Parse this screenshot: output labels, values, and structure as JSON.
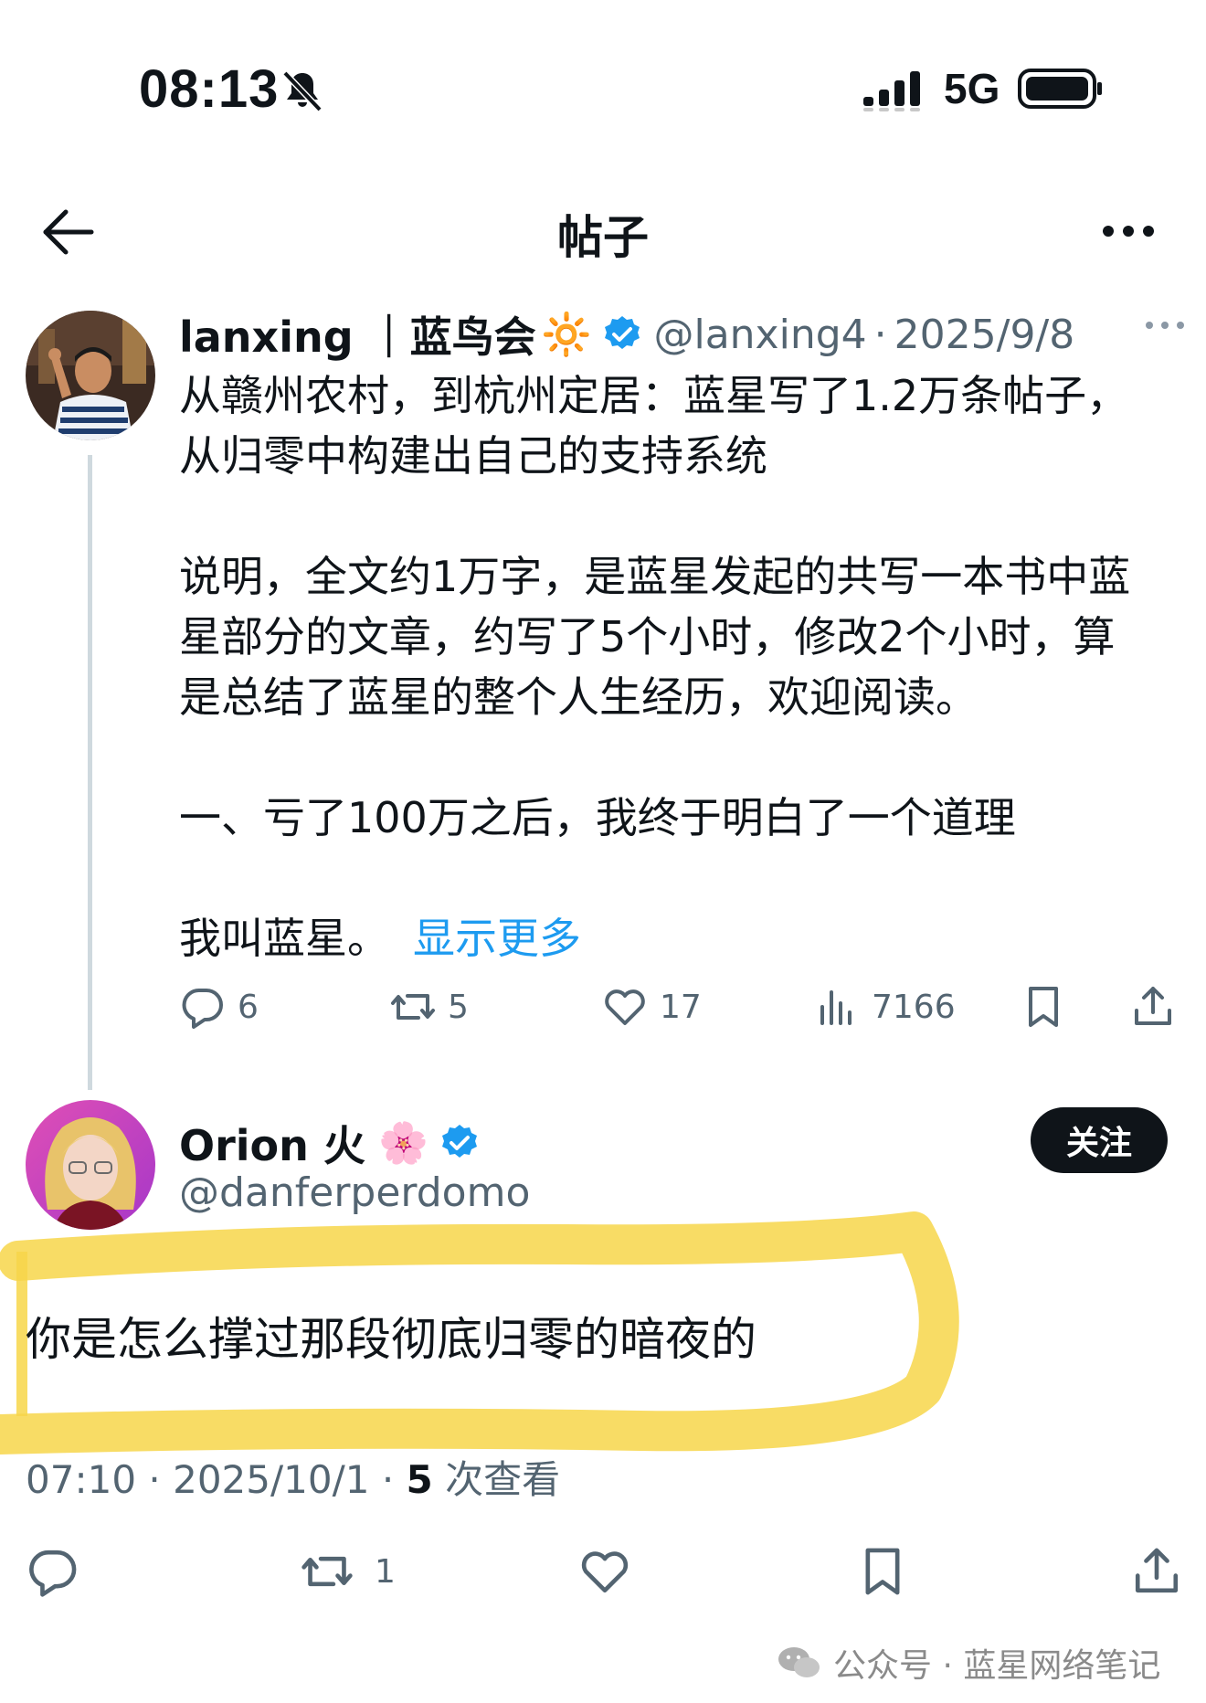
{
  "status_bar": {
    "time": "08:13",
    "network": "5G",
    "icons": [
      "bell-off-icon",
      "signal-icon",
      "battery-icon"
    ]
  },
  "header": {
    "title": "帖子",
    "icons": [
      "back-arrow-icon",
      "more-icon"
    ]
  },
  "tweet": {
    "author_name": "lanxing ｜蓝鸟会",
    "author_emoji": "🔆",
    "author_handle": "@lanxing4",
    "date": "2025/9/8",
    "body": "从赣州农村，到杭州定居：蓝星写了1.2万条帖子，\n从归零中构建出自己的支持系统\n\n说明，全文约1万字，是蓝星发起的共写一本书中蓝\n星部分的文章，约写了5个小时，修改2个小时，算\n是总结了蓝星的整个人生经历，欢迎阅读。\n\n一、亏了100万之后，我终于明白了一个道理\n\n我叫蓝星。",
    "show_more": "显示更多",
    "actions": {
      "replies": "6",
      "retweets": "5",
      "likes": "17",
      "views": "7166"
    }
  },
  "reply": {
    "author_name": "Orion 火",
    "author_emoji": "🌸",
    "author_handle": "@danferperdomo",
    "follow_label": "关注",
    "text": "你是怎么撑过那段彻底归零的暗夜的",
    "time": "07:10",
    "date": "2025/10/1",
    "views_count": "5",
    "views_label": "次查看",
    "actions": {
      "retweets": "1"
    }
  },
  "watermark": {
    "text": "公众号 · 蓝星网络笔记"
  },
  "colors": {
    "text": "#0f1419",
    "secondary": "#536471",
    "link": "#1d9bf0",
    "verified": "#1d9bf0",
    "highlight": "#f7d64a"
  }
}
